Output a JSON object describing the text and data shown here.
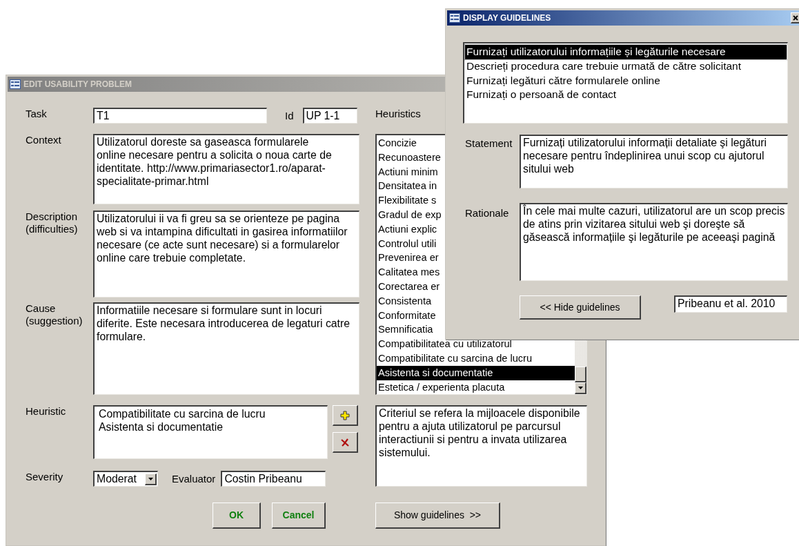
{
  "edit_window": {
    "title": "EDIT USABILITY PROBLEM",
    "task": {
      "label": "Task",
      "value": "T1"
    },
    "id": {
      "label": "Id",
      "value": "UP 1-1"
    },
    "context": {
      "label": "Context",
      "value": "Utilizatorul doreste sa gaseasca formularele\nonline necesare pentru a solicita o noua carte de identitate. http://www.primariasector1.ro/aparat-specialitate-primar.html"
    },
    "description": {
      "label": "Description (difficulties)",
      "value": "Utilizatorului ii va fi greu sa se orienteze pe pagina web si va intampina dificultati in gasirea informatiilor necesare (ce acte sunt necesare) si a formularelor online care trebuie completate."
    },
    "cause": {
      "label": "Cause (suggestion)",
      "value": "Informatiile necesare si formulare sunt in locuri diferite. Este necesara introducerea de legaturi catre formulare."
    },
    "heuristics": {
      "label": "Heuristics",
      "items": [
        {
          "text": "Concizie",
          "selected": false
        },
        {
          "text": "Recunoastere",
          "selected": false
        },
        {
          "text": "Actiuni minim",
          "selected": false
        },
        {
          "text": "Densitatea in",
          "selected": false
        },
        {
          "text": "Flexibilitate s",
          "selected": false
        },
        {
          "text": "Gradul de exp",
          "selected": false
        },
        {
          "text": "Actiuni explic",
          "selected": false
        },
        {
          "text": "Controlul utili",
          "selected": false
        },
        {
          "text": "Prevenirea er",
          "selected": false
        },
        {
          "text": "Calitatea mes",
          "selected": false
        },
        {
          "text": "Corectarea er",
          "selected": false
        },
        {
          "text": "Consistenta",
          "selected": false
        },
        {
          "text": "Conformitate",
          "selected": false
        },
        {
          "text": "Semnificatia",
          "selected": false
        },
        {
          "text": "Compatibilitatea cu utilizatorul",
          "selected": false
        },
        {
          "text": "Compatibilitate cu sarcina de lucru",
          "selected": false
        },
        {
          "text": "Asistenta si documentatie",
          "selected": true
        },
        {
          "text": "Estetica / experienta placuta",
          "selected": false
        }
      ]
    },
    "heuristic": {
      "label": "Heuristic",
      "items": [
        "Compatibilitate cu sarcina de lucru",
        "Asistenta si documentatie"
      ]
    },
    "heuristic_description": "Criteriul se refera la mijloacele disponibile pentru a ajuta utilizatorul pe parcursul interactiunii si pentru a invata utilizarea sistemului.",
    "severity": {
      "label": "Severity",
      "value": "Moderat"
    },
    "evaluator": {
      "label": "Evaluator",
      "value": "Costin Pribeanu"
    },
    "buttons": [
      {
        "kind": "ok",
        "label": "OK"
      },
      {
        "kind": "cancel",
        "label": "Cancel"
      },
      {
        "kind": "guidelines",
        "label": "Show guidelines  >>"
      }
    ]
  },
  "guidelines_window": {
    "title": "DISPLAY GUIDELINES",
    "items": [
      {
        "text": "Furnizați utilizatorului informațiile și legăturile necesare",
        "selected": true
      },
      {
        "text": "Descrieți procedura care trebuie urmată de către solicitant",
        "selected": false
      },
      {
        "text": "Furnizați legături către formularele online",
        "selected": false
      },
      {
        "text": "Furnizați o persoană de contact",
        "selected": false
      }
    ],
    "statement": {
      "label": "Statement",
      "value": "Furnizați utilizatorului informații detaliate şi legături necesare pentru îndeplinirea unui scop cu ajutorul sitului web"
    },
    "rationale": {
      "label": "Rationale",
      "value": "În cele mai multe cazuri, utilizatorul are un scop precis de atins prin vizitarea sitului web şi doreşte să găsească informațiile şi legăturile pe aceeaşi pagină"
    },
    "hide_button": "<< Hide guidelines",
    "source": "Pribeanu et al. 2010"
  }
}
